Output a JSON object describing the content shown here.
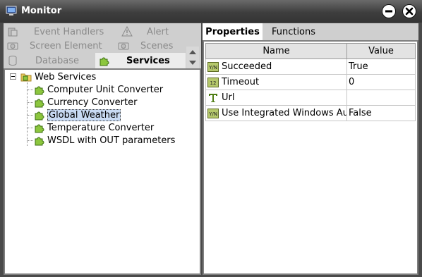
{
  "window": {
    "title": "Monitor"
  },
  "left_nav": {
    "items": [
      {
        "label": "Event Handlers",
        "icon": "event-handlers-icon"
      },
      {
        "label": "Alert",
        "icon": "alert-icon"
      },
      {
        "label": "Screen Element",
        "icon": "camera-icon"
      },
      {
        "label": "Scenes",
        "icon": "camera-icon"
      },
      {
        "label": "Database",
        "icon": "database-icon"
      },
      {
        "label": "Services",
        "icon": "puzzle-icon",
        "selected": true
      }
    ]
  },
  "tree": {
    "root": {
      "label": "Web Services",
      "icon": "folder-icon",
      "expanded": true
    },
    "children": [
      {
        "label": "Computer Unit Converter",
        "icon": "puzzle-icon"
      },
      {
        "label": "Currency Converter",
        "icon": "puzzle-icon"
      },
      {
        "label": "Global Weather",
        "icon": "puzzle-icon",
        "selected": true
      },
      {
        "label": "Temperature Converter",
        "icon": "puzzle-icon"
      },
      {
        "label": "WSDL with OUT parameters",
        "icon": "puzzle-icon"
      }
    ]
  },
  "right_tabs": [
    {
      "label": "Properties",
      "active": true
    },
    {
      "label": "Functions",
      "active": false
    }
  ],
  "properties": {
    "columns": [
      "Name",
      "Value"
    ],
    "rows": [
      {
        "name": "Succeeded",
        "value": "True",
        "icon": "boolean-type-icon"
      },
      {
        "name": "Timeout",
        "value": "0",
        "icon": "number-type-icon"
      },
      {
        "name": "Url",
        "value": "",
        "icon": "text-type-icon"
      },
      {
        "name": "Use Integrated Windows Au",
        "value": "False",
        "icon": "boolean-type-icon"
      }
    ]
  }
}
